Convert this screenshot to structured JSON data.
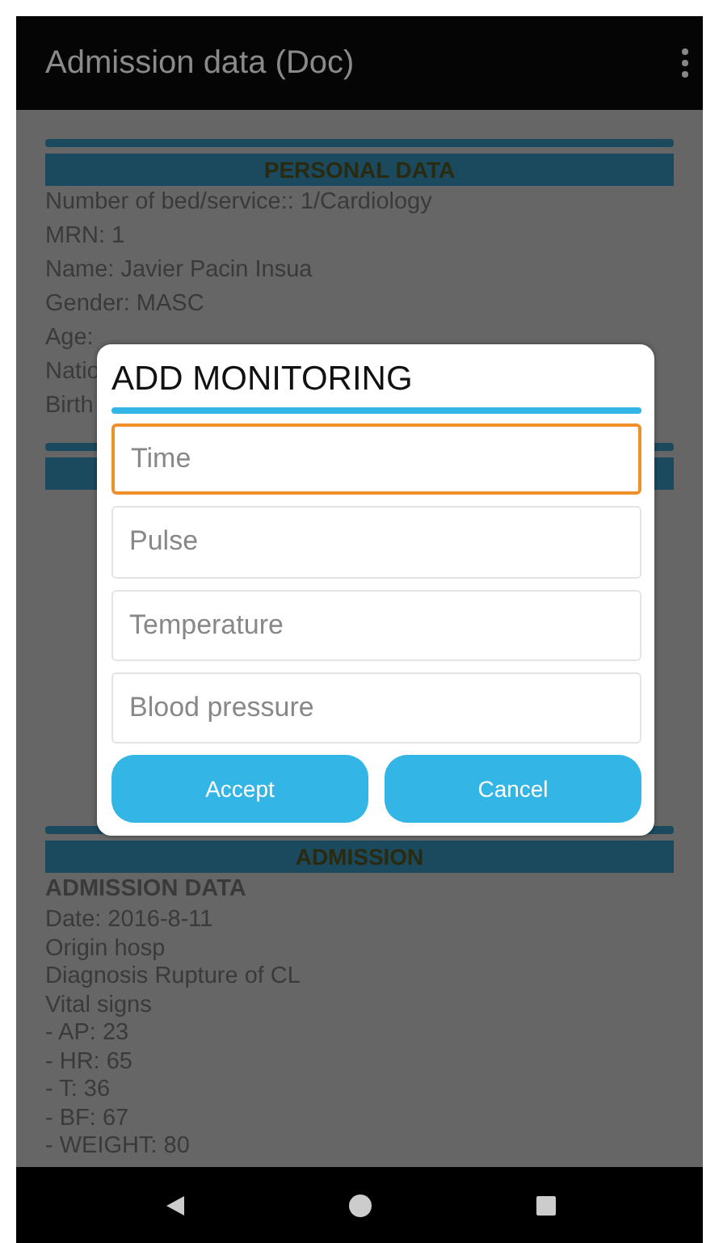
{
  "app_bar": {
    "title": "Admission data (Doc)"
  },
  "sections": [
    {
      "kind": "shown",
      "header": "PERSONAL DATA",
      "lines": [
        {
          "text": "Number of bed/service:: 1/Cardiology",
          "bold": false
        },
        {
          "text": "MRN: 1",
          "bold": false
        },
        {
          "text": "Name: Javier Pacin Insua",
          "bold": false
        },
        {
          "text": "Gender: MASC",
          "bold": false
        },
        {
          "text": "Age:",
          "bold": false
        },
        {
          "text": "Natio",
          "bold": false
        },
        {
          "text": "Birth",
          "bold": false
        }
      ]
    },
    {
      "kind": "covered"
    },
    {
      "kind": "shown",
      "header": "ADMISSION",
      "lines": [
        {
          "text": "ADMISSION DATA",
          "bold": true
        },
        {
          "text": "Date: 2016-8-11",
          "bold": false
        },
        {
          "text": "Origin hosp",
          "bold": false
        },
        {
          "text": "Diagnosis Rupture of CL",
          "bold": false
        },
        {
          "text": "Vital signs",
          "bold": false
        },
        {
          "text": "- AP: 23",
          "bold": false
        },
        {
          "text": "- HR: 65",
          "bold": false
        },
        {
          "text": "- T: 36",
          "bold": false
        },
        {
          "text": "- BF: 67",
          "bold": false
        },
        {
          "text": "- WEIGHT: 80",
          "bold": false
        }
      ]
    }
  ],
  "dialog": {
    "title": "ADD MONITORING",
    "fields": [
      {
        "placeholder": "Time",
        "focused": true
      },
      {
        "placeholder": "Pulse",
        "focused": false
      },
      {
        "placeholder": "Temperature",
        "focused": false
      },
      {
        "placeholder": "Blood pressure",
        "focused": false
      }
    ],
    "buttons": [
      "Accept",
      "Cancel"
    ]
  }
}
